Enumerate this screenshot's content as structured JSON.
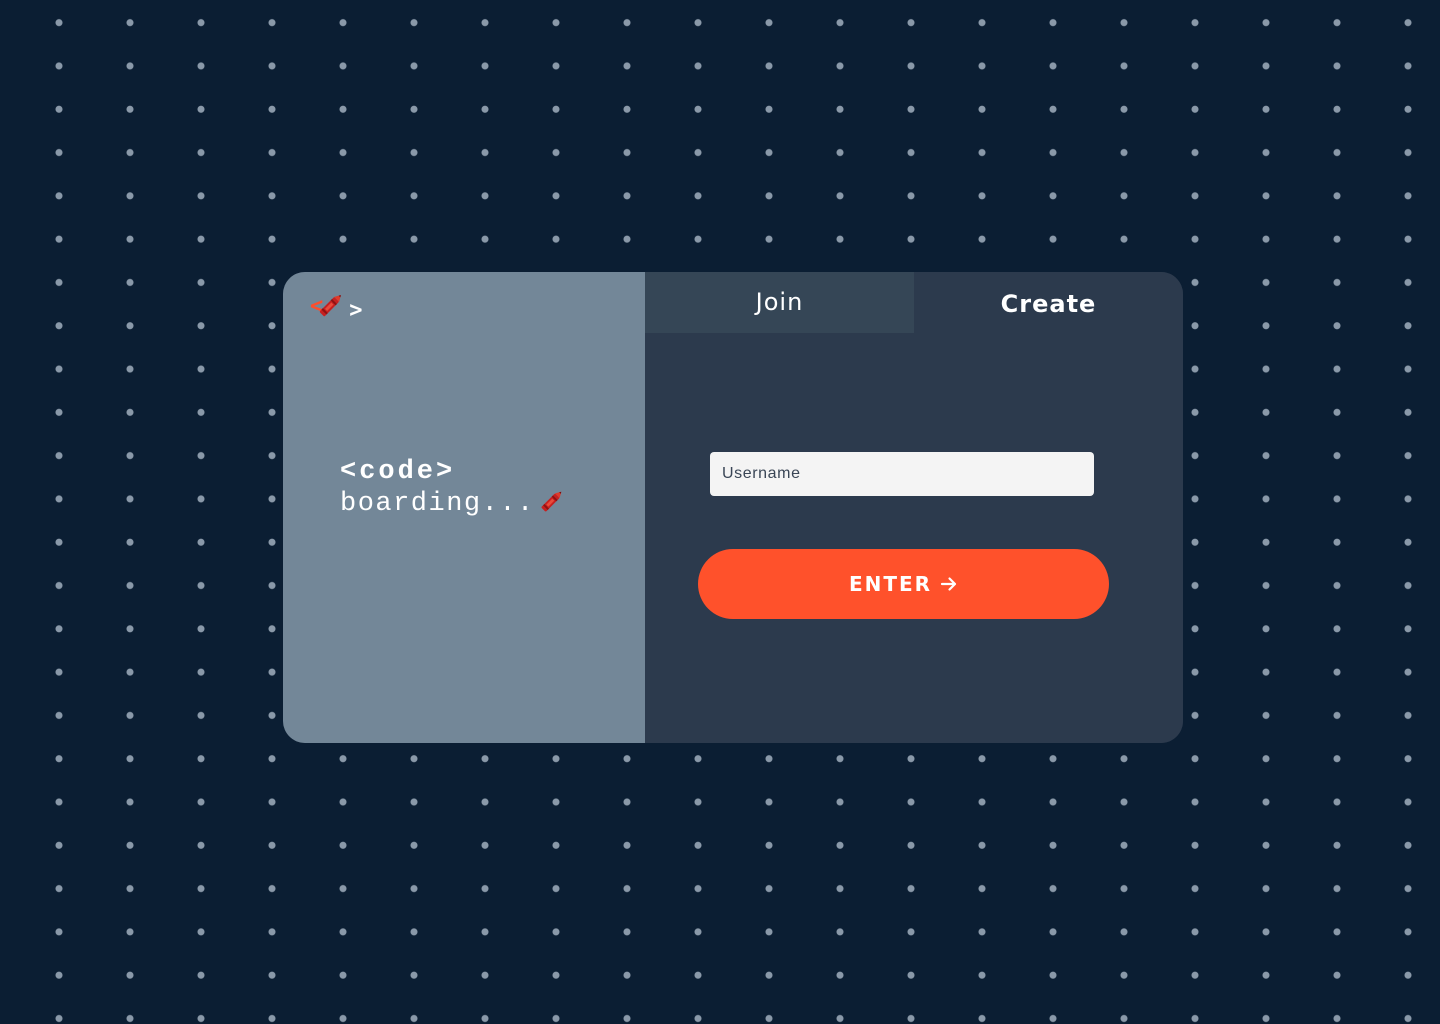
{
  "app": {
    "logo": {
      "open_bracket": "<",
      "close_bracket": ">",
      "icon": "crayon-icon"
    },
    "brand": {
      "line1": "<code>",
      "line2": "boarding...",
      "icon": "crayon-icon"
    }
  },
  "tabs": [
    {
      "label": "Join",
      "active": false
    },
    {
      "label": "Create",
      "active": true
    }
  ],
  "form": {
    "username_placeholder": "Username",
    "username_value": "",
    "enter_label": "ENTER",
    "enter_icon": "arrow-right-icon"
  },
  "colors": {
    "background": "#0b1e33",
    "left_panel": "#738798",
    "right_panel": "#2c3a4d",
    "inactive_tab": "#354656",
    "accent": "#ff512b"
  }
}
